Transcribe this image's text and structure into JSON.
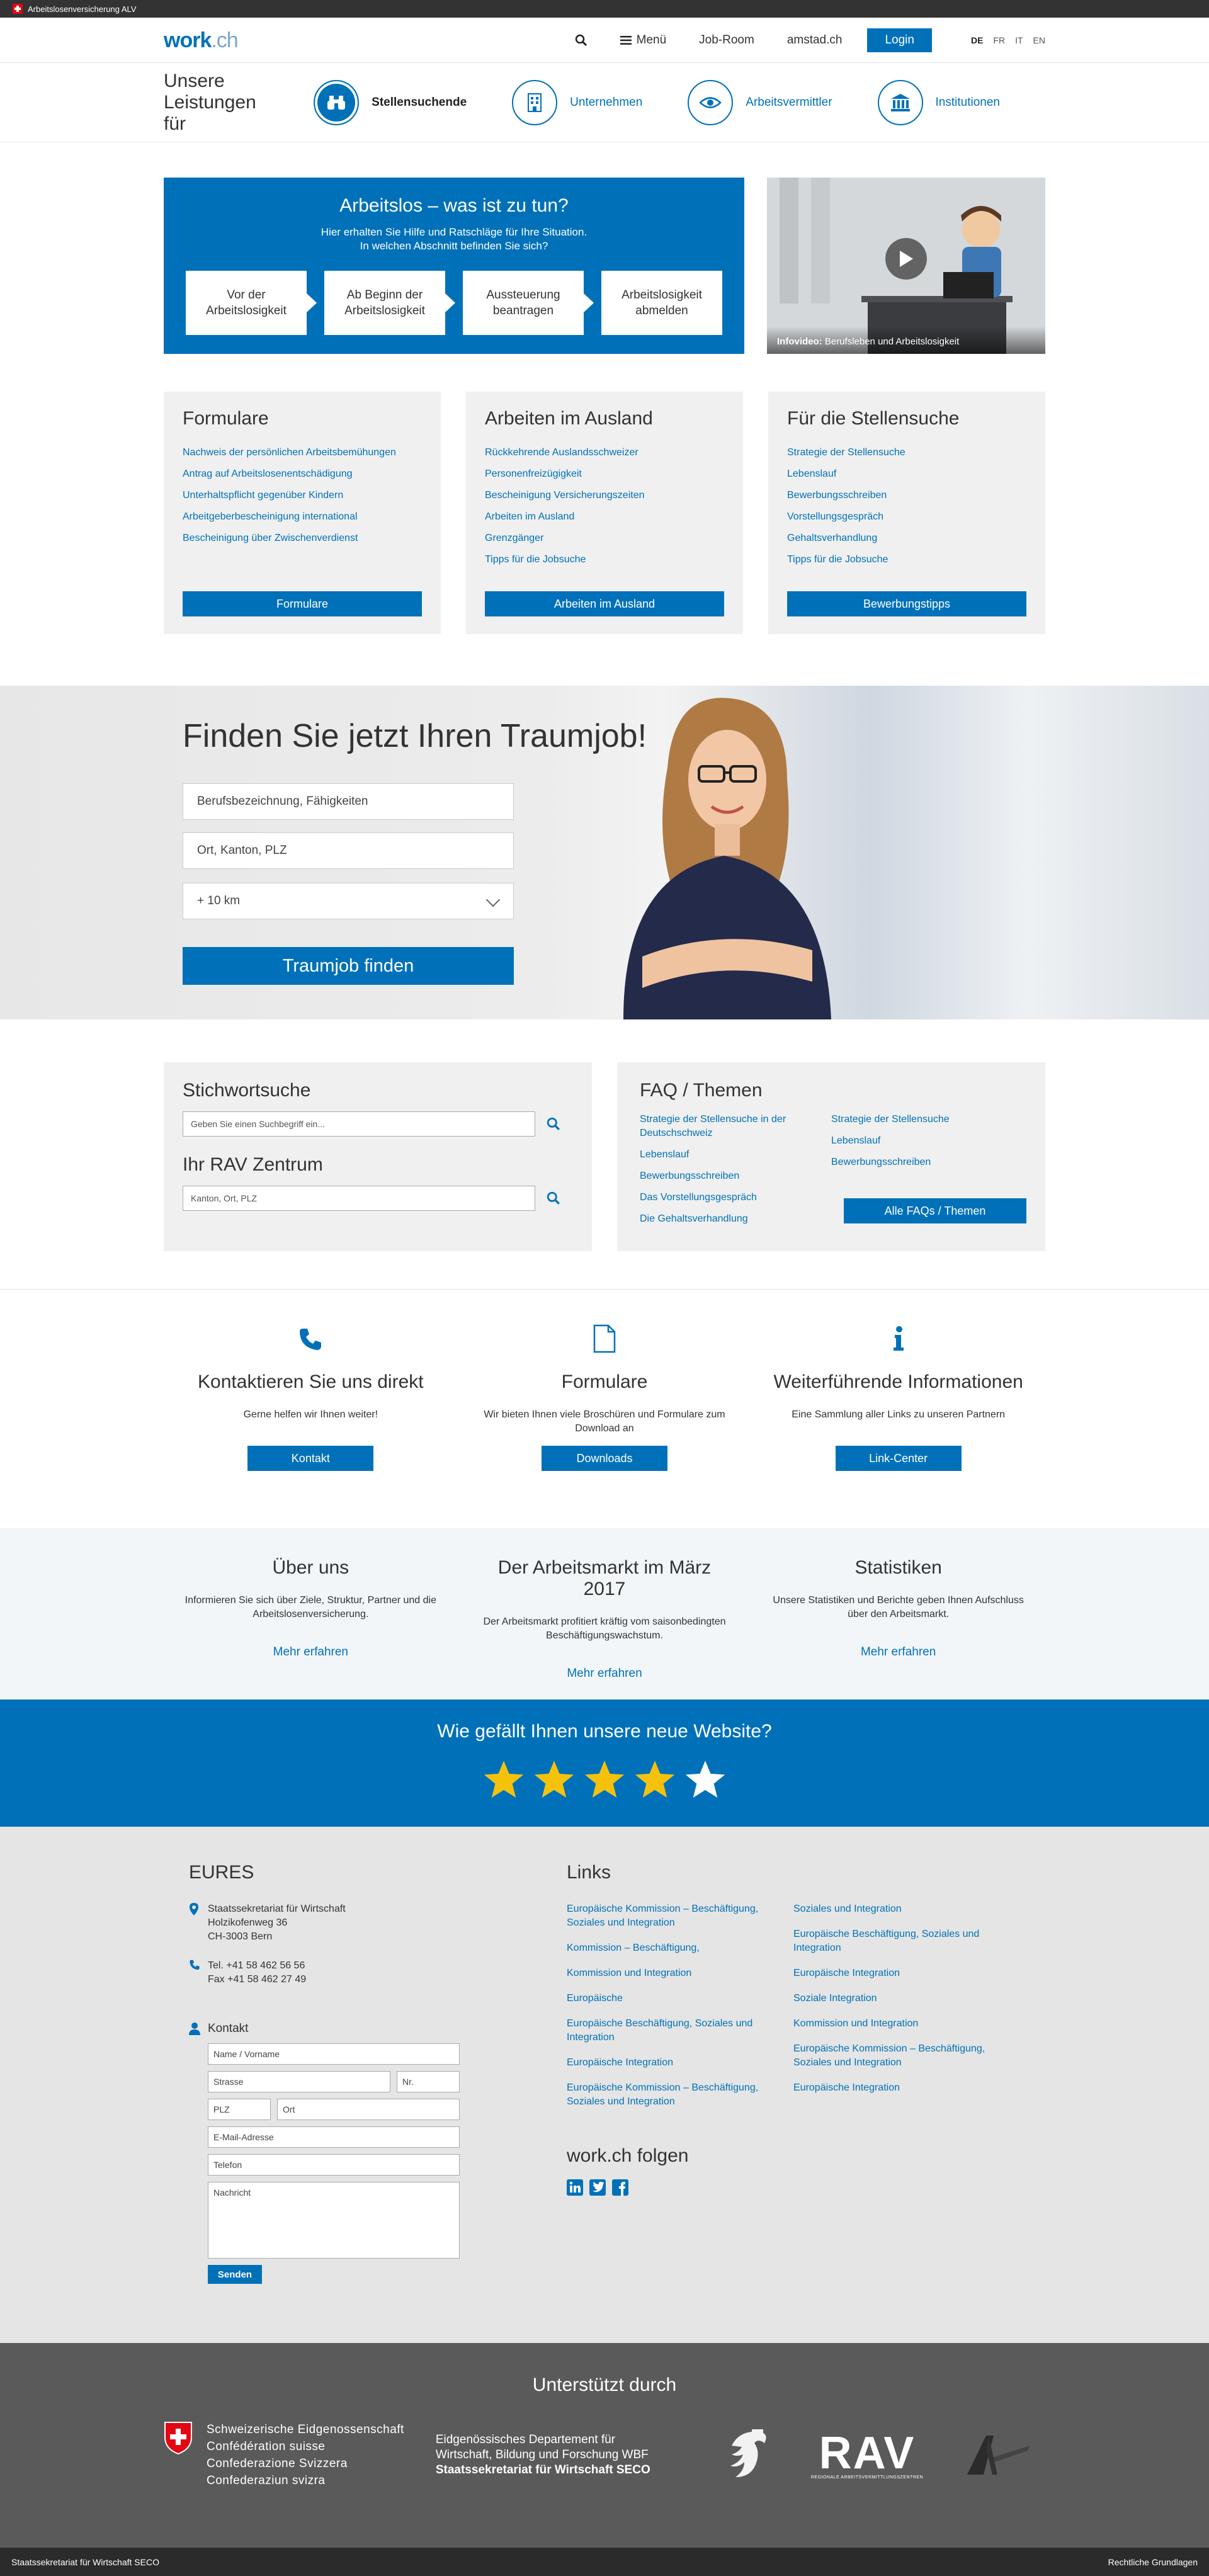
{
  "topbar": {
    "org": "Arbeitslosenversicherung ALV"
  },
  "header": {
    "logo_main": "work",
    "logo_suffix": ".ch",
    "menu": "Menü",
    "jobroom": "Job-Room",
    "amstad": "amstad.ch",
    "login": "Login",
    "langs": [
      "DE",
      "FR",
      "IT",
      "EN"
    ]
  },
  "services": {
    "lead": "Unsere Leistungen für",
    "items": [
      {
        "label": "Stellensuchende",
        "icon": "binoculars-icon"
      },
      {
        "label": "Unternehmen",
        "icon": "building-icon"
      },
      {
        "label": "Arbeitsvermittler",
        "icon": "eye-icon"
      },
      {
        "label": "Institutionen",
        "icon": "institution-icon"
      }
    ]
  },
  "arbeitslos": {
    "title": "Arbeitslos – was ist zu tun?",
    "subtitle1": "Hier erhalten Sie Hilfe und Ratschläge für Ihre Situation.",
    "subtitle2": "In welchen Abschnitt befinden Sie sich?",
    "steps": [
      "Vor der Arbeitslosigkeit",
      "Ab Beginn der Arbeitslosigkeit",
      "Aussteuerung beantragen",
      "Arbeitslosigkeit abmelden"
    ]
  },
  "video": {
    "label": "Infovideo:",
    "caption": "Berufsleben und Arbeitslosigkeit"
  },
  "cards": [
    {
      "title": "Formulare",
      "links": [
        "Nachweis der persönlichen Arbeitsbemühungen",
        "Antrag auf Arbeitslosenentschädigung",
        "Unterhaltspflicht gegenüber Kindern",
        "Arbeitgeberbescheinigung international",
        "Bescheinigung über Zwischenverdienst"
      ],
      "button": "Formulare"
    },
    {
      "title": "Arbeiten im Ausland",
      "links": [
        "Rückkehrende Auslandsschweizer",
        "Personenfreizügigkeit",
        "Bescheinigung Versicherungszeiten",
        "Arbeiten im Ausland",
        "Grenzgänger",
        "Tipps für die Jobsuche"
      ],
      "button": "Arbeiten im Ausland"
    },
    {
      "title": "Für die Stellensuche",
      "links": [
        "Strategie der Stellensuche",
        "Lebenslauf",
        "Bewerbungsschreiben",
        "Vorstellungsgespräch",
        "Gehaltsverhandlung",
        "Tipps für die Jobsuche"
      ],
      "button": "Bewerbungstipps"
    }
  ],
  "hero": {
    "title": "Finden Sie jetzt Ihren Traumjob!",
    "field1": "Berufsbezeichnung, Fähigkeiten",
    "field2": "Ort, Kanton, PLZ",
    "radius": "+ 10 km",
    "button": "Traumjob finden"
  },
  "stichwort": {
    "title": "Stichwortsuche",
    "placeholder": "Geben Sie einen Suchbegriff ein..."
  },
  "rav": {
    "title": "Ihr RAV Zentrum",
    "placeholder": "Kanton, Ort, PLZ"
  },
  "faq": {
    "title": "FAQ / Themen",
    "col1": [
      "Strategie der Stellensuche in der Deutschschweiz",
      "Lebenslauf",
      "Bewerbungsschreiben",
      "Das Vorstellungsgespräch",
      "Die Gehaltsverhandlung"
    ],
    "col2": [
      "Strategie der Stellensuche",
      "Lebenslauf",
      "Bewerbungsschreiben"
    ],
    "button": "Alle FAQs / Themen"
  },
  "contact_row": [
    {
      "icon": "phone-icon",
      "title": "Kontaktieren Sie uns direkt",
      "text": "Gerne helfen wir Ihnen weiter!",
      "button": "Kontakt"
    },
    {
      "icon": "document-icon",
      "title": "Formulare",
      "text": "Wir bieten Ihnen viele Broschüren und Formulare zum Download an",
      "button": "Downloads"
    },
    {
      "icon": "info-icon",
      "title": "Weiterführende Informationen",
      "text": "Eine Sammlung aller Links zu unseren Partnern",
      "button": "Link-Center"
    }
  ],
  "info_row": [
    {
      "title": "Über uns",
      "text": "Informieren Sie sich über Ziele, Struktur, Partner und die Arbeitslosenversicherung.",
      "link": "Mehr erfahren"
    },
    {
      "title": "Der Arbeitsmarkt im März 2017",
      "text": "Der Arbeitsmarkt profitiert kräftig vom saisonbedingten Beschäftigungswachstum.",
      "link": "Mehr erfahren"
    },
    {
      "title": "Statistiken",
      "text": "Unsere Statistiken und Berichte geben Ihnen Aufschluss über den Arbeitsmarkt.",
      "link": "Mehr erfahren"
    }
  ],
  "rating": {
    "title": "Wie gefällt Ihnen unsere neue Website?",
    "stars_filled": 4,
    "stars_total": 5,
    "star_color": "#f4c20d"
  },
  "eures": {
    "title": "EURES",
    "addr": [
      "Staatssekretariat für Wirtschaft",
      "Holzikofenweg 36",
      "CH-3003 Bern"
    ],
    "tel": "Tel. +41 58 462 56 56",
    "fax": "Fax +41 58 462 27 49",
    "kontakt": "Kontakt",
    "form": {
      "name": "Name / Vorname",
      "strasse": "Strasse",
      "nr": "Nr.",
      "plz": "PLZ",
      "ort": "Ort",
      "email": "E-Mail-Adresse",
      "telefon": "Telefon",
      "nachricht": "Nachricht",
      "send": "Senden"
    }
  },
  "links": {
    "title": "Links",
    "col1": [
      "Europäische Kommission – Beschäftigung, Soziales und Integration",
      "Kommission – Beschäftigung,",
      "Kommission und Integration",
      "Europäische",
      "Europäische Beschäftigung, Soziales und Integration",
      "Europäische Integration",
      "Europäische Kommission – Beschäftigung, Soziales und Integration"
    ],
    "col2": [
      "Soziales und Integration",
      "Europäische Beschäftigung, Soziales und Integration",
      "Europäische Integration",
      "Soziale Integration",
      "Kommission und Integration",
      "Europäische Kommission – Beschäftigung, Soziales und Integration",
      "Europäische Integration"
    ],
    "follow": "work.ch folgen"
  },
  "support": {
    "title": "Unterstützt durch",
    "eidg": [
      "Schweizerische Eidgenossenschaft",
      "Confédération suisse",
      "Confederazione Svizzera",
      "Confederaziun svizra"
    ],
    "wbf1": "Eidgenössisches Departement für",
    "wbf2": "Wirtschaft, Bildung und Forschung WBF",
    "seco": "Staatssekretariat für Wirtschaft SECO",
    "rav": "RAV",
    "rav_sub": "REGIONALE ARBEITSVERMITTLUNGSZENTREN"
  },
  "bottom": {
    "left": "Staatssekretariat für Wirtschaft SECO",
    "right": "Rechtliche Grundlagen"
  },
  "colors": {
    "brand": "#0071b9"
  }
}
